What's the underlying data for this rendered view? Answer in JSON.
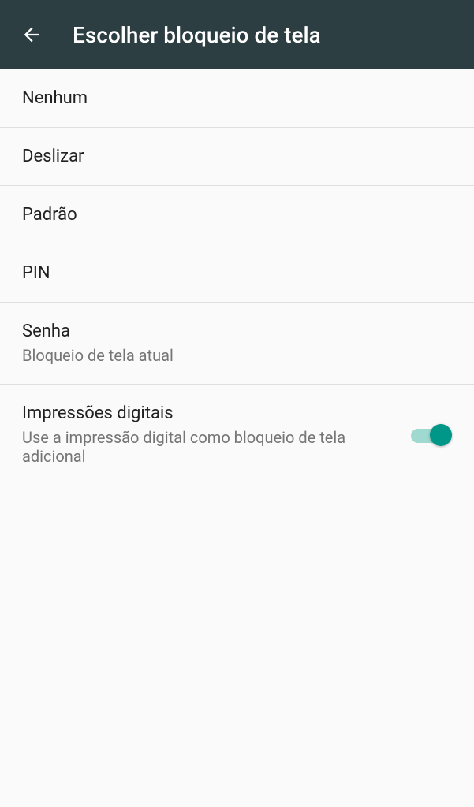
{
  "header": {
    "title": "Escolher bloqueio de tela"
  },
  "options": {
    "none": {
      "label": "Nenhum"
    },
    "swipe": {
      "label": "Deslizar"
    },
    "pattern": {
      "label": "Padrão"
    },
    "pin": {
      "label": "PIN"
    },
    "password": {
      "label": "Senha",
      "subtitle": "Bloqueio de tela atual"
    },
    "fingerprint": {
      "label": "Impressões digitais",
      "subtitle": "Use a impressão digital como bloqueio de tela adicional",
      "enabled": true
    }
  }
}
